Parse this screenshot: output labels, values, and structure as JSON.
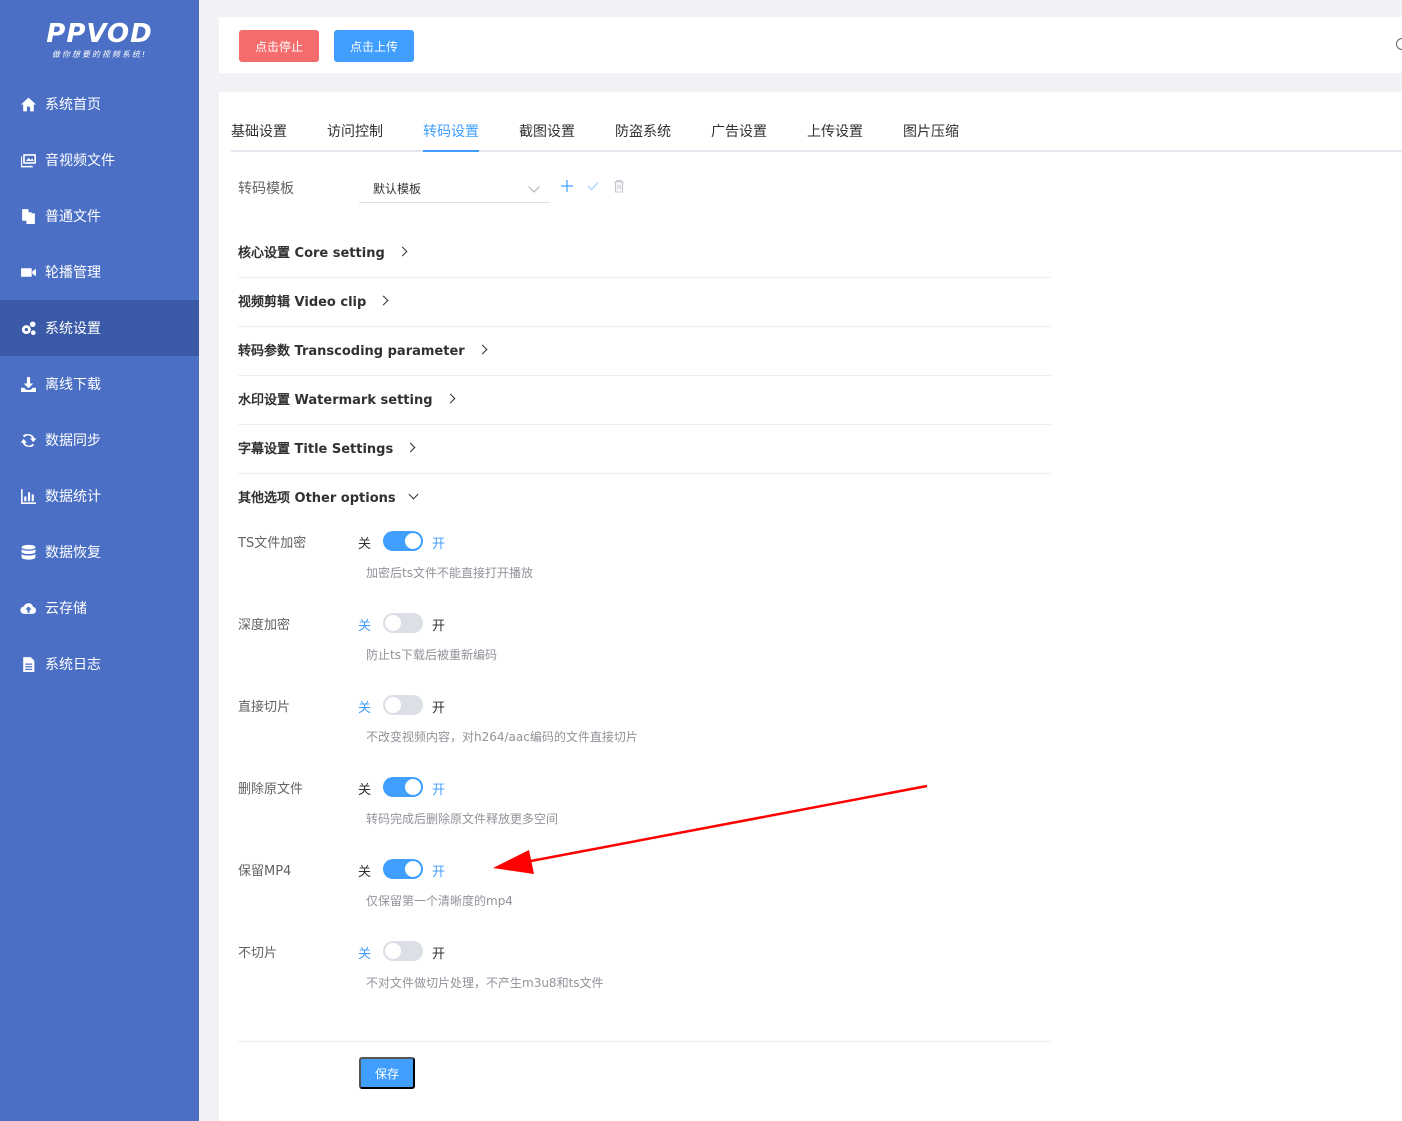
{
  "logo": {
    "title": "PPVOD",
    "slogan": "做你想要的视频系统!"
  },
  "sidebar": {
    "items": [
      {
        "label": "系统首页",
        "icon": "home-icon"
      },
      {
        "label": "音视频文件",
        "icon": "media-icon"
      },
      {
        "label": "普通文件",
        "icon": "files-icon"
      },
      {
        "label": "轮播管理",
        "icon": "video-camera-icon"
      },
      {
        "label": "系统设置",
        "icon": "gears-icon"
      },
      {
        "label": "离线下载",
        "icon": "download-icon"
      },
      {
        "label": "数据同步",
        "icon": "sync-icon"
      },
      {
        "label": "数据统计",
        "icon": "bar-chart-icon"
      },
      {
        "label": "数据恢复",
        "icon": "database-icon"
      },
      {
        "label": "云存储",
        "icon": "cloud-upload-icon"
      },
      {
        "label": "系统日志",
        "icon": "document-icon"
      }
    ],
    "active_index": 4
  },
  "topbar": {
    "stop_label": "点击停止",
    "upload_label": "点击上传"
  },
  "tabs": [
    "基础设置",
    "访问控制",
    "转码设置",
    "截图设置",
    "防盗系统",
    "广告设置",
    "上传设置",
    "图片压缩"
  ],
  "active_tab": "转码设置",
  "template": {
    "label": "转码模板",
    "value": "默认模板"
  },
  "sections": [
    {
      "title": "核心设置 Core setting",
      "expanded": false
    },
    {
      "title": "视频剪辑 Video clip",
      "expanded": false
    },
    {
      "title": "转码参数 Transcoding parameter",
      "expanded": false
    },
    {
      "title": "水印设置 Watermark setting",
      "expanded": false
    },
    {
      "title": "字幕设置 Title Settings",
      "expanded": false
    },
    {
      "title": "其他选项 Other options",
      "expanded": true
    }
  ],
  "switch_texts": {
    "off": "关",
    "on": "开"
  },
  "options": [
    {
      "label": "TS文件加密",
      "on": true,
      "hint": "加密后ts文件不能直接打开播放"
    },
    {
      "label": "深度加密",
      "on": false,
      "hint": "防止ts下载后被重新编码"
    },
    {
      "label": "直接切片",
      "on": false,
      "hint": "不改变视频内容，对h264/aac编码的文件直接切片"
    },
    {
      "label": "删除原文件",
      "on": true,
      "hint": "转码完成后删除原文件释放更多空间"
    },
    {
      "label": "保留MP4",
      "on": true,
      "hint": "仅保留第一个清晰度的mp4"
    },
    {
      "label": "不切片",
      "on": false,
      "hint": "不对文件做切片处理，不产生m3u8和ts文件"
    }
  ],
  "save_label": "保存",
  "colors": {
    "sidebar": "#4b6fc4",
    "primary": "#409eff",
    "danger": "#f56c6c",
    "annotation_arrow": "#ff0000"
  }
}
